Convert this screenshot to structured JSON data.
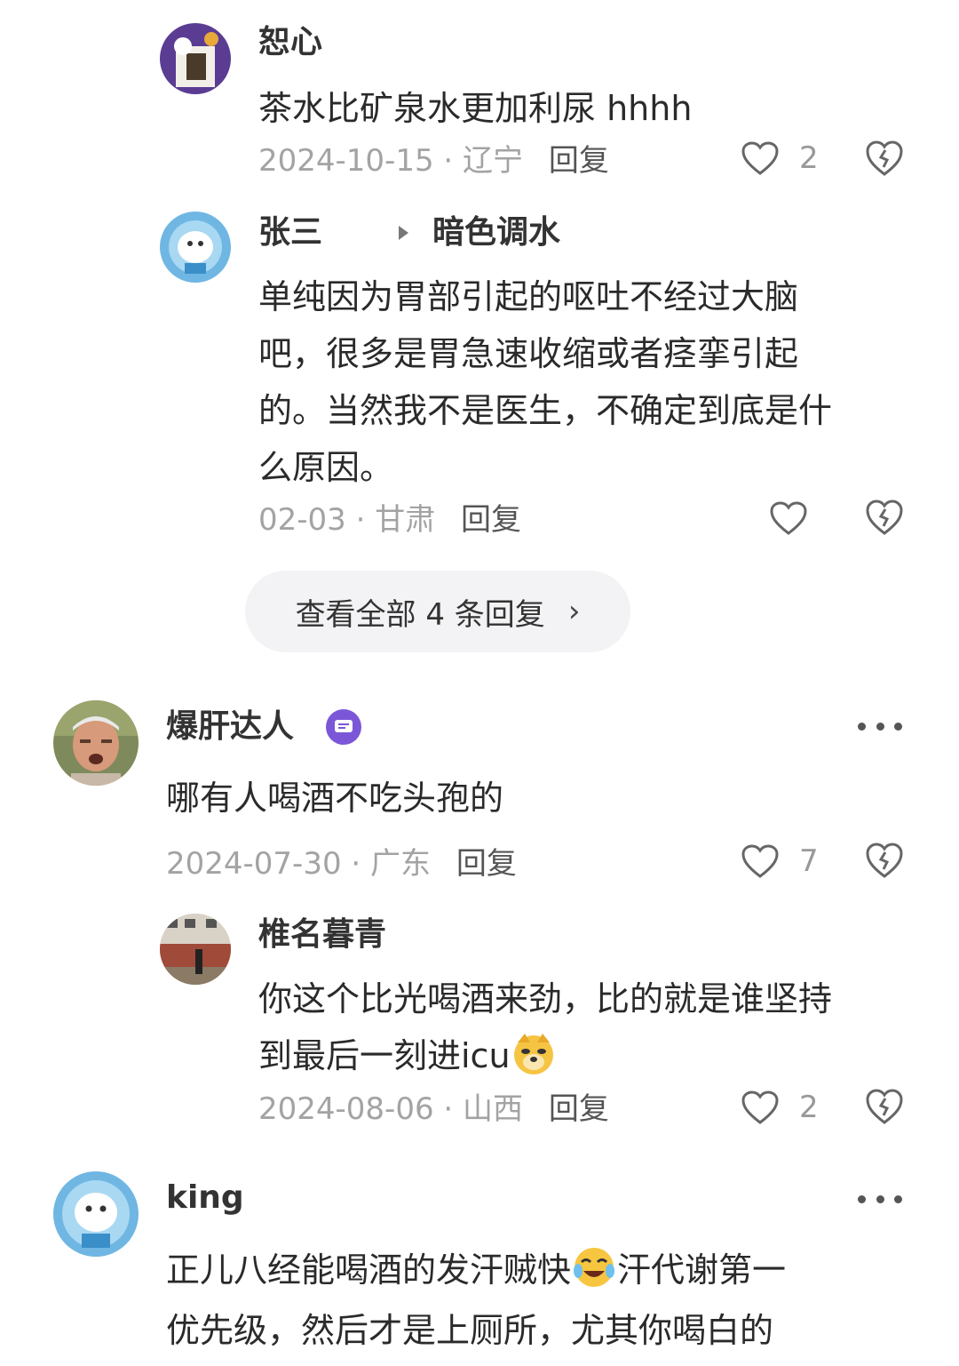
{
  "comments": {
    "c1": {
      "name": "恕心",
      "text": "茶水比矿泉水更加利尿 hhhh",
      "date": "2024-10-15",
      "sep": "·",
      "region": "辽宁",
      "reply": "回复",
      "likes": "2"
    },
    "c2": {
      "name": "张三",
      "reply_to": "暗色调水",
      "lines": [
        "单纯因为胃部引起的呕吐不经过大脑",
        "吧，很多是胃急速收缩或者痉挛引起",
        "的。当然我不是医生，不确定到底是什",
        "么原因。"
      ],
      "date": "02-03",
      "sep": "·",
      "region": "甘肃",
      "reply": "回复"
    },
    "view_all": "查看全部 4 条回复",
    "view_all_chevron": "›",
    "c3": {
      "name": "爆肝达人",
      "text": "哪有人喝酒不吃头孢的",
      "date": "2024-07-30",
      "sep": "·",
      "region": "广东",
      "reply": "回复",
      "likes": "7"
    },
    "c4": {
      "name": "椎名暮青",
      "line1": "你这个比光喝酒来劲，比的就是谁坚持",
      "line2": "到最后一刻进icu",
      "date": "2024-08-06",
      "sep": "·",
      "region": "山西",
      "reply": "回复",
      "likes": "2"
    },
    "c5": {
      "name": "king",
      "line1a": "正儿八经能喝酒的发汗贼快",
      "line1b": "汗代谢第一",
      "line2": "优先级，然后才是上厕所，尤其你喝白的"
    }
  },
  "colors": {
    "badge": "#7b57d8",
    "meta": "#a3a3a3",
    "view_all_bg": "#f3f3f5"
  },
  "icons": [
    "heart-outline-icon",
    "broken-heart-icon",
    "more-dots-icon",
    "chevron-right-icon",
    "triangle-arrow-icon",
    "doge-emoji",
    "crying-laughing-emoji",
    "verified-badge-icon"
  ]
}
